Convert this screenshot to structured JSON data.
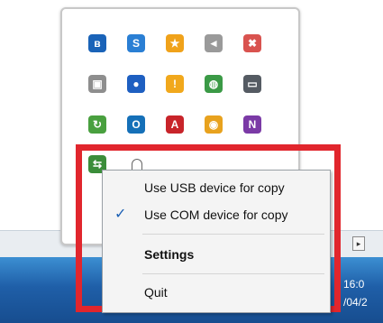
{
  "taskbar": {
    "clock_time": "16:0",
    "clock_date": "/04/2",
    "overflow_arrow": "▸"
  },
  "tray_icons": [
    {
      "name": "bluetooth-icon",
      "glyph": "ʙ",
      "color": "#1a63b8"
    },
    {
      "name": "network-app-icon",
      "glyph": "S",
      "color": "#2a7fd4"
    },
    {
      "name": "star-badge-icon",
      "glyph": "★",
      "color": "#f0a21a"
    },
    {
      "name": "volume-icon",
      "glyph": "◄",
      "color": "#9a9a9a"
    },
    {
      "name": "wifi-error-icon",
      "glyph": "✖",
      "color": "#d9534f"
    },
    {
      "name": "camera-icon",
      "glyph": "▣",
      "color": "#8e8e8e"
    },
    {
      "name": "blue-circle-app-icon",
      "glyph": "●",
      "color": "#1e5fc1"
    },
    {
      "name": "warning-shield-icon",
      "glyph": "!",
      "color": "#f1a81c"
    },
    {
      "name": "globe-icon",
      "glyph": "◍",
      "color": "#3b9a46"
    },
    {
      "name": "monitor-icon",
      "glyph": "▭",
      "color": "#555b63"
    },
    {
      "name": "sync-icon",
      "glyph": "↻",
      "color": "#49a03f"
    },
    {
      "name": "outlook-icon",
      "glyph": "O",
      "color": "#1570b8"
    },
    {
      "name": "pdf-icon",
      "glyph": "A",
      "color": "#c8242a"
    },
    {
      "name": "chrome-icon",
      "glyph": "◉",
      "color": "#e8a21e"
    },
    {
      "name": "onenote-icon",
      "glyph": "N",
      "color": "#7b3aa6"
    }
  ],
  "app_icon": {
    "glyph": "⇆",
    "color": "#3b8d3a"
  },
  "menu": {
    "items": [
      {
        "label": "Use USB device for copy",
        "checked": false,
        "bold": false
      },
      {
        "label": "Use COM device for copy",
        "checked": true,
        "bold": false
      },
      {
        "label": "Settings",
        "checked": false,
        "bold": true
      },
      {
        "label": "Quit",
        "checked": false,
        "bold": false
      }
    ],
    "check_mark": "✓"
  }
}
